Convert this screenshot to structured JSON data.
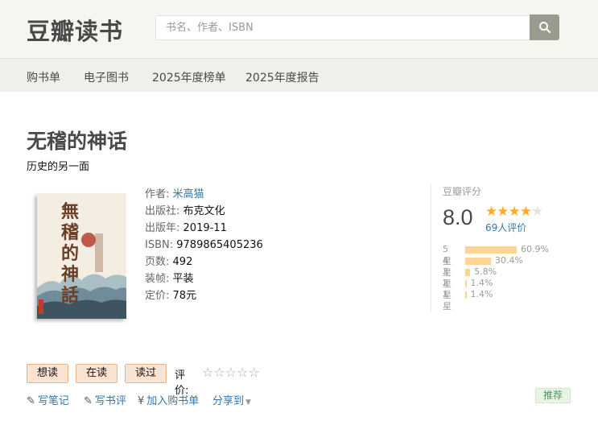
{
  "header": {
    "logo": "豆瓣读书",
    "search_placeholder": "书名、作者、ISBN"
  },
  "nav": {
    "items": [
      {
        "label": "购书单"
      },
      {
        "label": "电子图书"
      },
      {
        "label": "2025年度榜单"
      },
      {
        "label": "2025年度报告"
      }
    ]
  },
  "book": {
    "title": "无稽的神话",
    "subtitle": "历史的另一面",
    "cover_text": "無稽的神話",
    "author_label": "作者:",
    "author": "米高猫",
    "publisher_label": "出版社:",
    "publisher": "布克文化",
    "year_label": "出版年:",
    "year": "2019-11",
    "isbn_label": "ISBN:",
    "isbn": "9789865405236",
    "pages_label": "页数:",
    "pages": "492",
    "binding_label": "装帧:",
    "binding": "平装",
    "price_label": "定价:",
    "price": "78元"
  },
  "rating": {
    "title": "豆瓣评分",
    "score": "8.0",
    "stars_filled": 4,
    "stars_total": 5,
    "count_text": "69人评价",
    "distribution": [
      {
        "label": "5星",
        "percent": 60.9,
        "text": "60.9%"
      },
      {
        "label": "4星",
        "percent": 30.4,
        "text": "30.4%"
      },
      {
        "label": "3星",
        "percent": 5.8,
        "text": "5.8%"
      },
      {
        "label": "2星",
        "percent": 1.4,
        "text": "1.4%"
      },
      {
        "label": "1星",
        "percent": 1.4,
        "text": "1.4%"
      }
    ]
  },
  "actions": {
    "want": "想读",
    "reading": "在读",
    "read": "读过",
    "rate_label": "评价:",
    "rate_stars": "☆☆☆☆☆"
  },
  "links": {
    "note": "写笔记",
    "review": "写书评",
    "cart": "加入购书单",
    "share": "分享到",
    "recommend": "推荐"
  },
  "colors": {
    "link": "#3377aa",
    "star": "#ffac2d",
    "bar": "#ffd596",
    "button_bg": "#fbe3d2"
  }
}
